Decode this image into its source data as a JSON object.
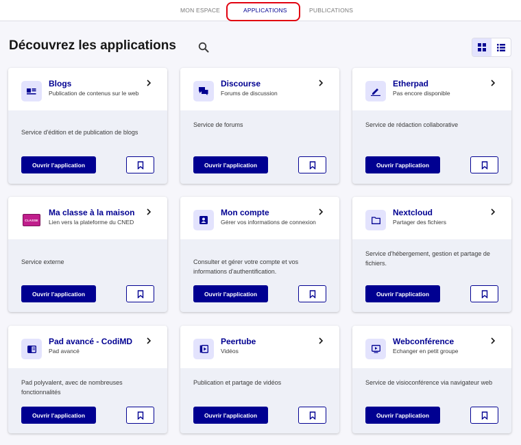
{
  "nav": {
    "tabs": [
      {
        "label": "MON ESPACE"
      },
      {
        "label": "APPLICATIONS"
      },
      {
        "label": "PUBLICATIONS"
      }
    ]
  },
  "page": {
    "title": "Découvrez les applications"
  },
  "colors": {
    "primary": "#000091",
    "highlight": "#e1000f",
    "icon_bg": "#e3e3fd",
    "card_body": "#eef0f7"
  },
  "common": {
    "open_label": "Ouvrir l'application"
  },
  "apps": [
    {
      "name": "Blogs",
      "subtitle": "Publication de contenus sur le web",
      "description": "Service d'édition et de publication de blogs",
      "icon": "blog-icon"
    },
    {
      "name": "Discourse",
      "subtitle": "Forums de discussion",
      "description": "Service de forums",
      "icon": "forum-icon"
    },
    {
      "name": "Etherpad",
      "subtitle": "Pas encore disponible",
      "description": "Service de rédaction collaborative",
      "icon": "edit-icon"
    },
    {
      "name": "Ma classe à la maison",
      "subtitle": "Lien vers la plateforme du CNED",
      "description": "Service externe",
      "icon": "ma-classe-logo-icon",
      "logo_text": "CLASSE"
    },
    {
      "name": "Mon compte",
      "subtitle": "Gérer vos informations de connexion",
      "description": "Consulter et gérer votre compte et vos informations d'authentification.",
      "icon": "account-icon"
    },
    {
      "name": "Nextcloud",
      "subtitle": "Partager des fichiers",
      "description": "Service d'hébergement, gestion et partage de fichiers.",
      "icon": "folder-icon"
    },
    {
      "name": "Pad avancé - CodiMD",
      "subtitle": "Pad avancé",
      "description": "Pad polyvalent, avec de nombreuses fonctionnalités",
      "icon": "pad-icon"
    },
    {
      "name": "Peertube",
      "subtitle": "Vidéos",
      "description": "Publication et partage de vidéos",
      "icon": "video-icon"
    },
    {
      "name": "Webconférence",
      "subtitle": "Echanger en petit groupe",
      "description": "Service de visioconférence via navigateur web",
      "icon": "webconference-icon"
    }
  ]
}
